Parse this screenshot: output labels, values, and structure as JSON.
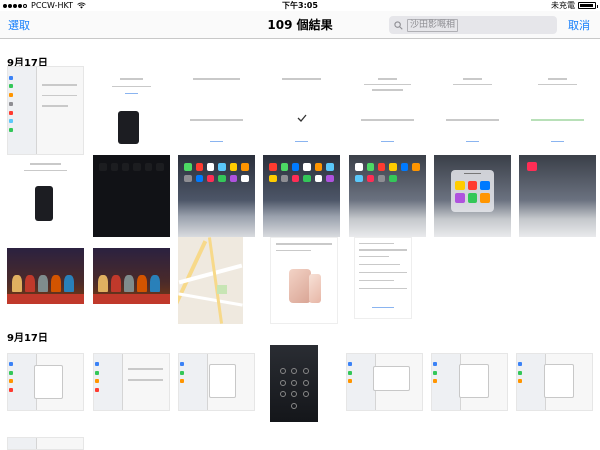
{
  "status_bar": {
    "carrier": "PCCW-HKT",
    "time": "下午3:05",
    "charging": "未充電",
    "signal_strength": 4,
    "icons": [
      "signal-dots-icon",
      "wifi-icon",
      "battery-icon"
    ]
  },
  "nav": {
    "select_label": "選取",
    "title": "109 個結果",
    "search_text": "沙田影嘅相",
    "cancel_label": "取消",
    "accent_color": "#147efb"
  },
  "sections": [
    {
      "header": "9月17日"
    },
    {
      "header": "9月17日"
    }
  ]
}
